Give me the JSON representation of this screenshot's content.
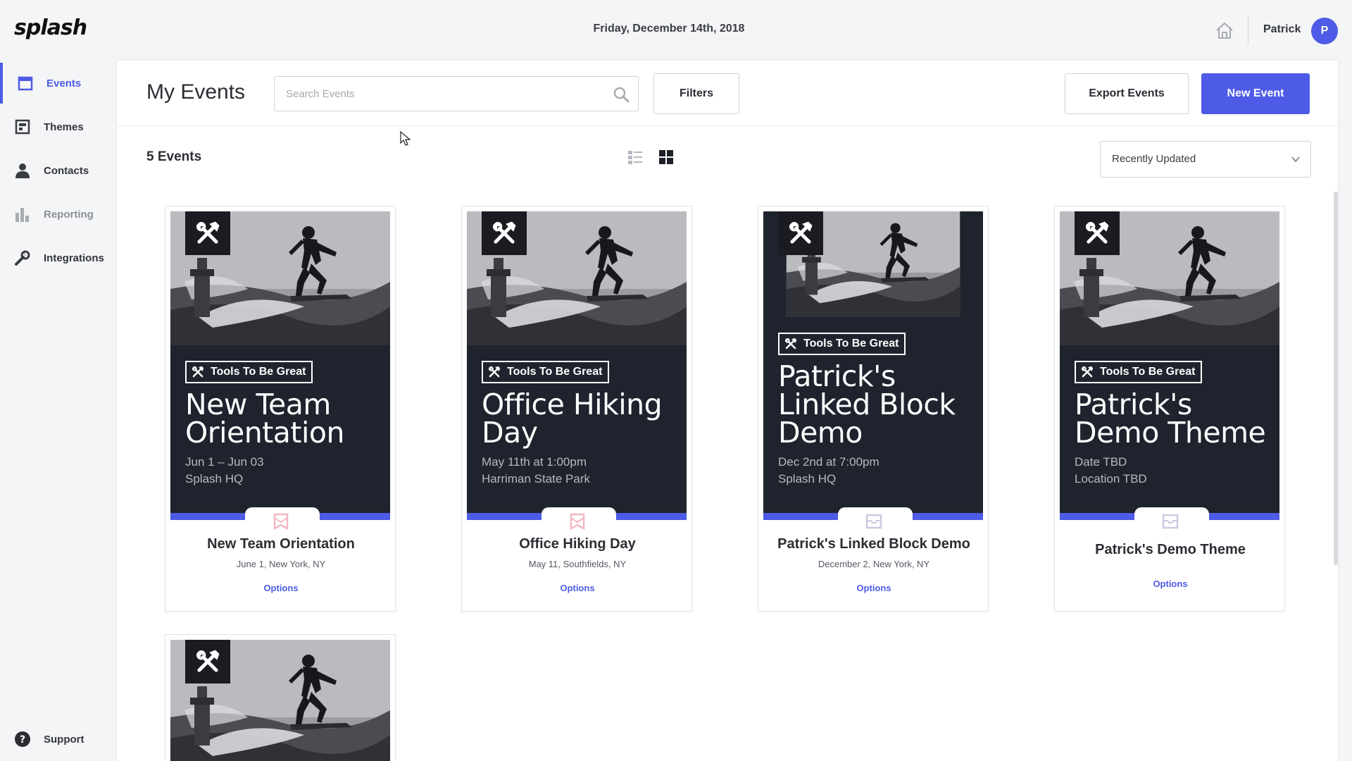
{
  "app": {
    "logo": "splash",
    "date": "Friday, December 14th, 2018"
  },
  "user": {
    "name": "Patrick",
    "initial": "P"
  },
  "sidebar": {
    "items": [
      {
        "label": "Events",
        "icon": "calendar-icon",
        "active": true
      },
      {
        "label": "Themes",
        "icon": "theme-icon"
      },
      {
        "label": "Contacts",
        "icon": "person-icon"
      },
      {
        "label": "Reporting",
        "icon": "bar-chart-icon"
      },
      {
        "label": "Integrations",
        "icon": "wrench-icon"
      }
    ],
    "support": "Support"
  },
  "header": {
    "title": "My Events",
    "search_placeholder": "Search Events",
    "filters": "Filters",
    "export": "Export Events",
    "new_event": "New Event"
  },
  "toolbar": {
    "count": "5 Events",
    "sort": "Recently Updated"
  },
  "colors": {
    "accent": "#4d5be6",
    "poster_bg": "#1f232d",
    "published_icon": "#f2b8c4",
    "draft_icon": "#c9cbe0"
  },
  "events": [
    {
      "brand": "Tools To Be Great",
      "poster_title": "New Team Orientation",
      "poster_date": "Jun 1 – Jun 03",
      "poster_location": "Splash HQ",
      "name": "New Team Orientation",
      "info": "June 1, New York, NY",
      "options": "Options",
      "status_icon": "published-icon"
    },
    {
      "brand": "Tools To Be Great",
      "poster_title": "Office Hiking Day",
      "poster_date": "May 11th at 1:00pm",
      "poster_location": "Harriman State Park",
      "name": "Office Hiking Day",
      "info": "May 11, Southfields, NY",
      "options": "Options",
      "status_icon": "published-icon"
    },
    {
      "brand": "Tools To Be Great",
      "poster_title": "Patrick's Linked Block Demo",
      "poster_date": "Dec 2nd at 7:00pm",
      "poster_location": "Splash HQ",
      "name": "Patrick's Linked Block Demo",
      "info": "December 2, New York, NY",
      "options": "Options",
      "status_icon": "draft-icon"
    },
    {
      "brand": "Tools To Be Great",
      "poster_title": "Patrick's Demo Theme",
      "poster_date": "Date TBD",
      "poster_location": "Location TBD",
      "name": "Patrick's Demo Theme",
      "info": "",
      "options": "Options",
      "status_icon": "draft-icon"
    }
  ]
}
